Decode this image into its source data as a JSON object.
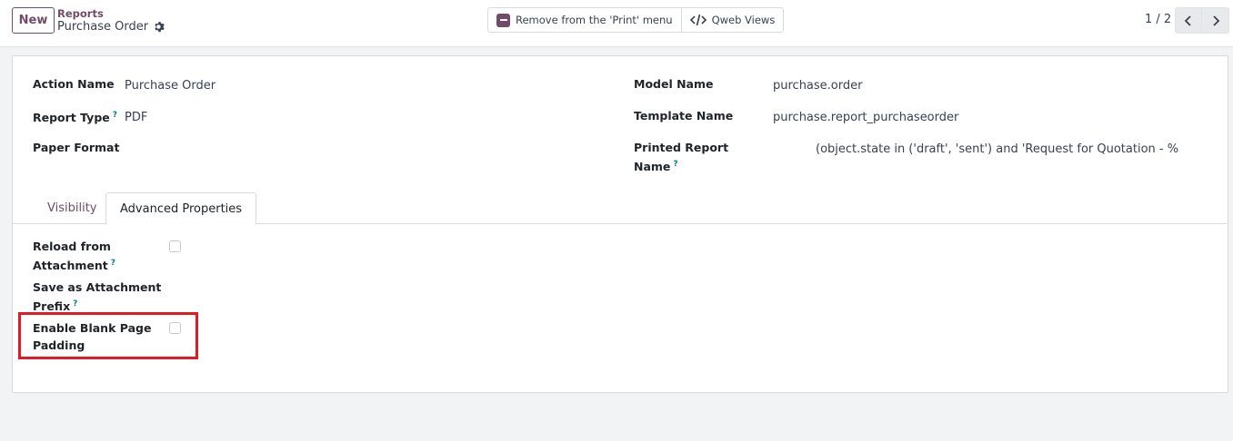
{
  "control_panel": {
    "new_label": "New",
    "breadcrumb_parent": "Reports",
    "breadcrumb_current": "Purchase Order",
    "actions": {
      "remove_print_label": "Remove from the 'Print' menu",
      "qweb_views_label": "Qweb Views"
    },
    "pager": "1 / 2"
  },
  "form": {
    "action_name": {
      "label": "Action Name",
      "value": "Purchase Order"
    },
    "report_type": {
      "label": "Report Type",
      "help": "?",
      "value": "PDF"
    },
    "paper_format": {
      "label": "Paper Format",
      "value": ""
    },
    "model_name": {
      "label": "Model Name",
      "value": "purchase.order"
    },
    "template_name": {
      "label": "Template Name",
      "value": "purchase.report_purchaseorder"
    },
    "printed_report_name": {
      "label_line1": "Printed Report",
      "label_line2": "Name",
      "help": "?",
      "value": "(object.state in ('draft', 'sent') and 'Request for Quotation - %s' % (obje"
    }
  },
  "tabs": [
    {
      "label": "Visibility",
      "active": false
    },
    {
      "label": "Advanced Properties",
      "active": true
    }
  ],
  "advanced": {
    "reload_attachment": {
      "label_line1": "Reload from",
      "label_line2": "Attachment",
      "help": "?",
      "checked": false
    },
    "attachment_prefix": {
      "label_line1": "Save as Attachment",
      "label_line2": "Prefix",
      "help": "?"
    },
    "blank_page_padding": {
      "label_line1": "Enable Blank Page",
      "label_line2": "Padding",
      "checked": false
    }
  },
  "colors": {
    "brand": "#714b67",
    "help": "#017e84",
    "highlight": "#e01b24"
  }
}
